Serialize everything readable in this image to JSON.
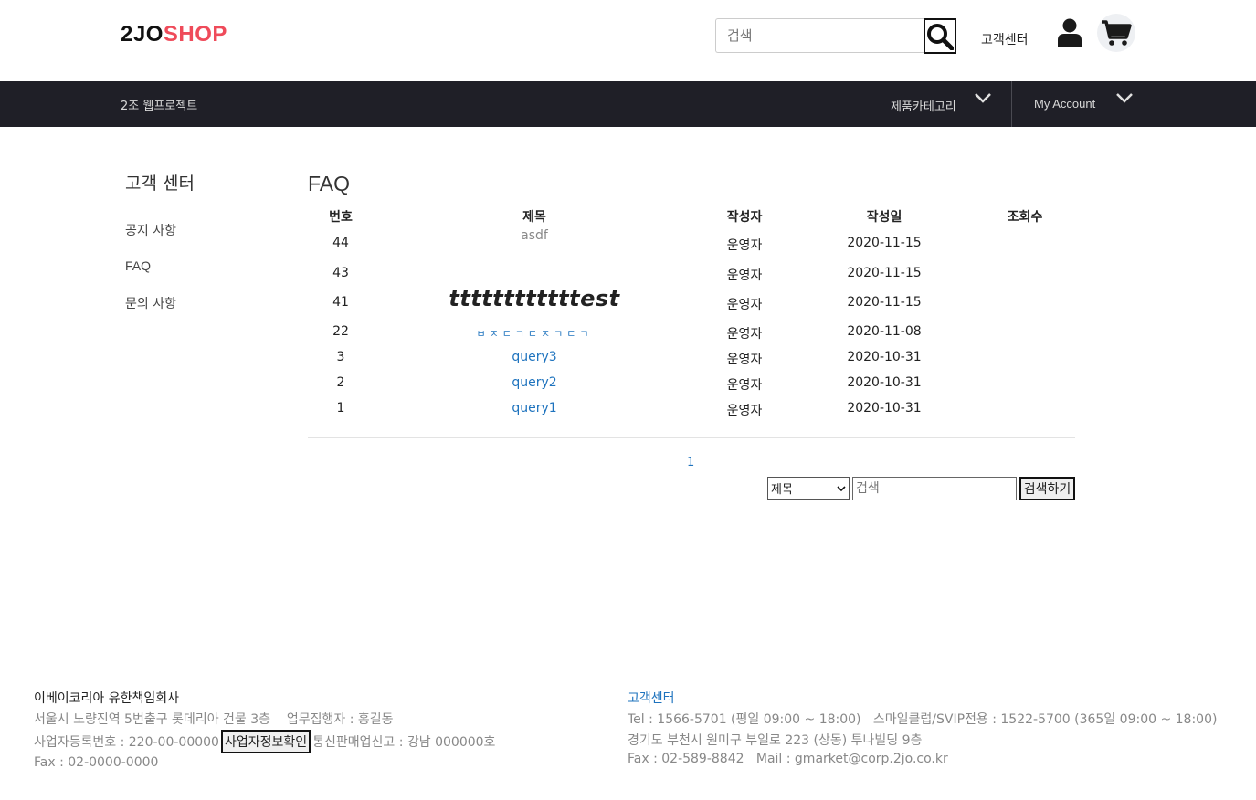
{
  "header": {
    "logo_a": "2JO",
    "logo_b": "SHOP",
    "search_placeholder": "검색",
    "cs_link": "고객센터",
    "icons": [
      "search-icon",
      "user-icon",
      "cart-icon"
    ]
  },
  "nav": {
    "title": "2조 웹프로젝트",
    "category": "제품카테고리",
    "account": "My Account"
  },
  "sidebar": {
    "title": "고객 센터",
    "items": [
      {
        "label": "공지 사항"
      },
      {
        "label": "FAQ"
      },
      {
        "label": "문의 사항"
      }
    ]
  },
  "main": {
    "title": "FAQ",
    "columns": [
      "번호",
      "제목",
      "작성자",
      "작성일",
      "조회수"
    ],
    "rows": [
      {
        "no": "44",
        "title": "asdf",
        "writer": "운영자",
        "date": "2020-11-15",
        "views": ""
      },
      {
        "no": "43",
        "title": "",
        "writer": "운영자",
        "date": "2020-11-15",
        "views": ""
      },
      {
        "no": "41",
        "title": "ttttttttttttest",
        "writer": "운영자",
        "date": "2020-11-15",
        "views": ""
      },
      {
        "no": "22",
        "title": "ㅂㅈㄷㄱㄷㅈㄱㄷㄱ",
        "writer": "운영자",
        "date": "2020-11-08",
        "views": ""
      },
      {
        "no": "3",
        "title": "query3",
        "writer": "운영자",
        "date": "2020-10-31",
        "views": ""
      },
      {
        "no": "2",
        "title": "query2",
        "writer": "운영자",
        "date": "2020-10-31",
        "views": ""
      },
      {
        "no": "1",
        "title": "query1",
        "writer": "운영자",
        "date": "2020-10-31",
        "views": ""
      }
    ],
    "page": "1",
    "search": {
      "select_value": "제목",
      "placeholder": "검색",
      "button": "검색하기"
    }
  },
  "footer": {
    "company": "이베이코리아 유한책임회사",
    "address": "서울시 노량진역 5번출구 롯데리아 건물 3층",
    "ceo": "업무집행자 : 홍길동",
    "biz_no": "사업자등록번호 : 220-00-00000",
    "biz_btn": "사업자정보확인",
    "mail_order": "통신판매업신고 : 강남 000000호",
    "fax": "Fax : 02-0000-0000",
    "cs_title": "고객센터",
    "tel": "Tel : 1566-5701 (평일 09:00 ~ 18:00)   스마일클럽/SVIP전용 : 1522-5700 (365일 09:00 ~ 18:00)",
    "address2": "경기도 부천시 원미구 부일로 223 (상동) 투나빌딩 9층",
    "fax_mail": "Fax : 02-589-8842   Mail : gmarket@corp.2jo.co.kr"
  }
}
